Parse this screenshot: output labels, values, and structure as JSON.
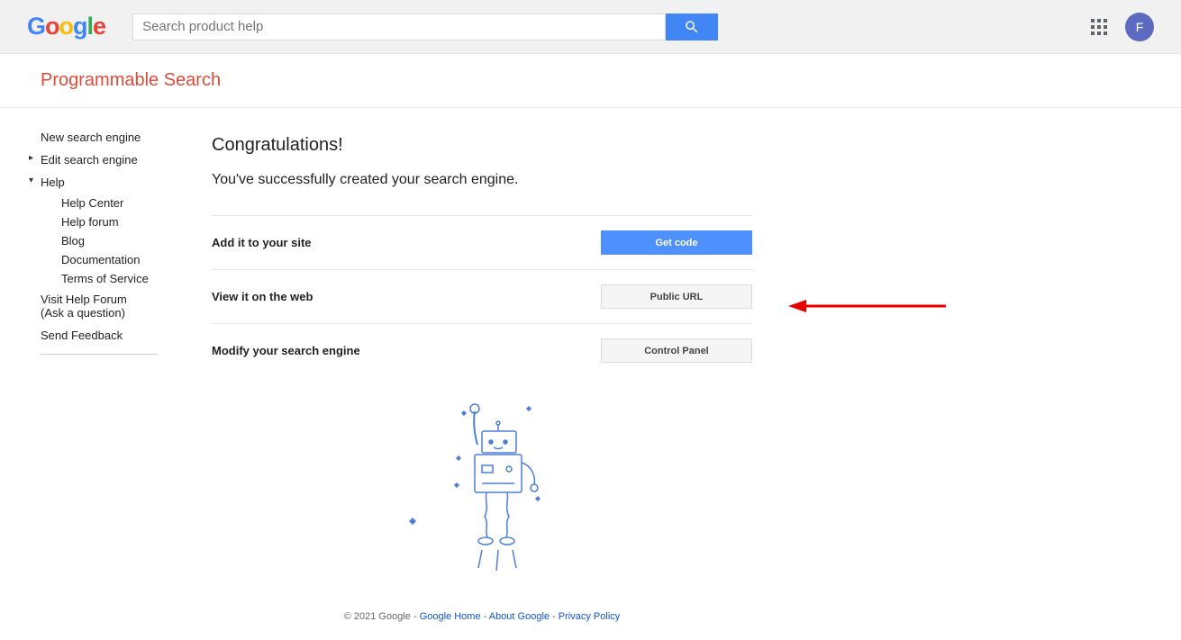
{
  "header": {
    "search_placeholder": "Search product help",
    "avatar_letter": "F"
  },
  "title": "Programmable Search",
  "sidebar": {
    "new_engine": "New search engine",
    "edit_engine": "Edit search engine",
    "help": "Help",
    "help_sub": {
      "help_center": "Help Center",
      "help_forum": "Help forum",
      "blog": "Blog",
      "documentation": "Documentation",
      "tos": "Terms of Service"
    },
    "visit_forum": "Visit Help Forum",
    "visit_forum_sub": "(Ask a question)",
    "send_feedback": "Send Feedback"
  },
  "main": {
    "heading": "Congratulations!",
    "subheading": "You've successfully created your search engine.",
    "rows": {
      "add": {
        "label": "Add it to your site",
        "button": "Get code"
      },
      "view": {
        "label": "View it on the web",
        "button": "Public URL"
      },
      "modify": {
        "label": "Modify your search engine",
        "button": "Control Panel"
      }
    }
  },
  "footer": {
    "copyright": "© 2021 Google ",
    "links": {
      "home": "Google Home",
      "about": "About Google",
      "privacy": "Privacy Policy"
    }
  }
}
